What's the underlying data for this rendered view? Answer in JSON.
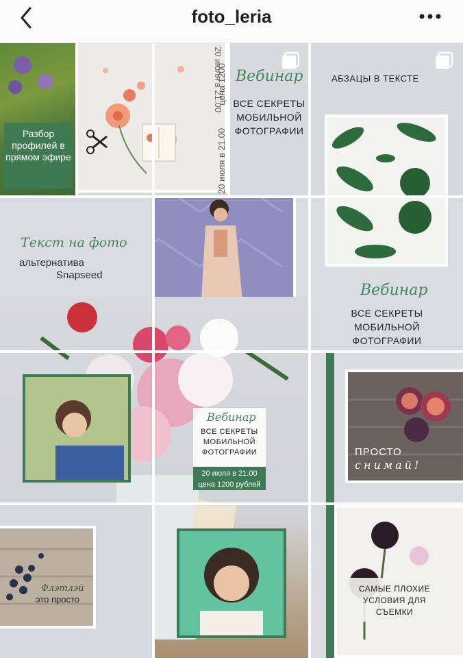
{
  "header": {
    "username": "foto_leria",
    "back_icon": "chevron-left-icon",
    "more_icon": "more-horizontal-icon"
  },
  "posts": {
    "p1": {
      "text": "Разбор профилей в прямом эфире"
    },
    "p2": {
      "vertical_date": "20 июля в 21.00",
      "vertical_price": "цена 1200"
    },
    "p3": {
      "script": "Вебинар",
      "line1": "ВСЕ СЕКРЕТЫ",
      "line2": "МОБИЛЬНОЙ",
      "line3": "ФОТОГРАФИИ"
    },
    "p4": {
      "heading": "АБЗАЦЫ В ТЕКСТЕ"
    },
    "p5": {
      "script": "Текст на фото",
      "line1": "альтернатива",
      "line2": "Snapseed"
    },
    "p7": {
      "script": "Вебинар",
      "line1": "ВСЕ СЕКРЕТЫ",
      "line2": "МОБИЛЬНОЙ",
      "line3": "ФОТОГРАФИИ"
    },
    "center_card": {
      "script": "Вебинар",
      "line1": "ВСЕ СЕКРЕТЫ",
      "line2": "МОБИЛЬНОЙ",
      "line3": "ФОТОГРАФИИ",
      "badge1": "20 июля в 21.00",
      "badge2": "цена 1200 рублей"
    },
    "p9": {
      "line1": "ПРОСТО",
      "script": "снимай!"
    },
    "p10": {
      "script": "Флэтлэй",
      "line1": "это просто"
    },
    "p12": {
      "line1": "САМЫЕ ПЛОХИЕ",
      "line2": "УСЛОВИЯ ДЛЯ",
      "line3": "СЪЕМКИ"
    }
  },
  "colors": {
    "accent_green": "#3d7a55",
    "grid_bg": "#dcdde2"
  }
}
